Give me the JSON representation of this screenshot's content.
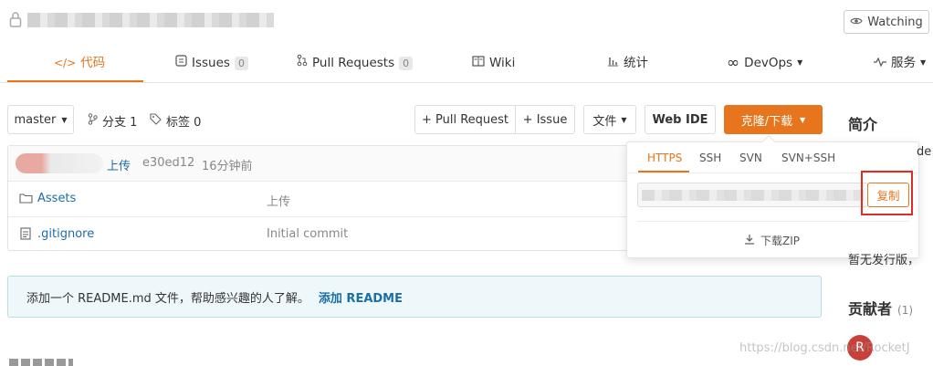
{
  "header": {
    "watch_label": "Watching"
  },
  "tabs": [
    {
      "label": "代码"
    },
    {
      "label": "Issues",
      "count": "0"
    },
    {
      "label": "Pull Requests",
      "count": "0"
    },
    {
      "label": "Wiki"
    },
    {
      "label": "统计"
    },
    {
      "label": "DevOps"
    },
    {
      "label": "服务"
    }
  ],
  "toolbar": {
    "branch": "master",
    "branches": "分支 1",
    "tags": "标签 0",
    "pull_request": "+ Pull Request",
    "issue": "+ Issue",
    "file": "文件",
    "web_ide": "Web IDE",
    "clone": "克隆/下载"
  },
  "commit": {
    "message": "上传",
    "hash": "e30ed12",
    "time": "16分钟前"
  },
  "files": [
    {
      "name": "Assets",
      "commit": "上传",
      "type": "folder"
    },
    {
      "name": ".gitignore",
      "commit": "Initial commit",
      "type": "file"
    }
  ],
  "readme": {
    "text": "添加一个 README.md 文件，帮助感兴趣的人了解。",
    "action": "添加 README"
  },
  "clone_popup": {
    "tabs": [
      "HTTPS",
      "SSH",
      "SVN",
      "SVN+SSH"
    ],
    "active_tab": "HTTPS",
    "copy_label": "复制",
    "download_label": "下载ZIP"
  },
  "sidebar": {
    "intro_title": "简介",
    "intro_text_1": "de",
    "intro_text_2": "暂无发行版，",
    "contributors_title": "贡献者",
    "contributors_count": "(1)",
    "avatar_letter": "R"
  },
  "watermark": "https://blog.csdn.net/RocketJ",
  "colors": {
    "accent": "#e6751d",
    "link": "#1b6fa8",
    "highlight_border": "#d93025"
  }
}
